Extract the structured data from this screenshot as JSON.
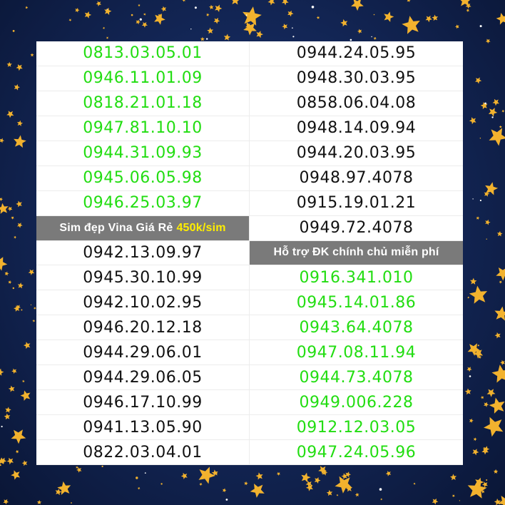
{
  "colors": {
    "green_number": "#22dd11",
    "black_number": "#111111",
    "banner_bg": "#7a7a7a",
    "banner_text": "#ffffff",
    "price_text": "#ffee00",
    "background": "#14285a",
    "star": "#f2b22e"
  },
  "left_column": [
    {
      "text": "0813.03.05.01",
      "color": "green"
    },
    {
      "text": "0946.11.01.09",
      "color": "green"
    },
    {
      "text": "0818.21.01.18",
      "color": "green"
    },
    {
      "text": "0947.81.10.10",
      "color": "green"
    },
    {
      "text": "0944.31.09.93",
      "color": "green"
    },
    {
      "text": "0945.06.05.98",
      "color": "green"
    },
    {
      "text": "0946.25.03.97",
      "color": "green"
    },
    {
      "text": "Sim đẹp Vina Giá Rẻ",
      "color": "banner",
      "price": "450k/sim"
    },
    {
      "text": "0942.13.09.97",
      "color": "black"
    },
    {
      "text": "0945.30.10.99",
      "color": "black"
    },
    {
      "text": "0942.10.02.95",
      "color": "black"
    },
    {
      "text": "0946.20.12.18",
      "color": "black"
    },
    {
      "text": "0944.29.06.01",
      "color": "black"
    },
    {
      "text": "0944.29.06.05",
      "color": "black"
    },
    {
      "text": "0946.17.10.99",
      "color": "black"
    },
    {
      "text": "0941.13.05.90",
      "color": "black"
    },
    {
      "text": "0822.03.04.01",
      "color": "black"
    }
  ],
  "right_column": [
    {
      "text": "0944.24.05.95",
      "color": "black"
    },
    {
      "text": "0948.30.03.95",
      "color": "black"
    },
    {
      "text": "0858.06.04.08",
      "color": "black"
    },
    {
      "text": "0948.14.09.94",
      "color": "black"
    },
    {
      "text": "0944.20.03.95",
      "color": "black"
    },
    {
      "text": "0948.97.4078",
      "color": "black"
    },
    {
      "text": "0915.19.01.21",
      "color": "black"
    },
    {
      "text": "0949.72.4078",
      "color": "black"
    },
    {
      "text": "Hỗ trợ ĐK chính chủ miễn phí",
      "color": "banner"
    },
    {
      "text": "0916.341.010",
      "color": "green"
    },
    {
      "text": "0945.14.01.86",
      "color": "green"
    },
    {
      "text": "0943.64.4078",
      "color": "green"
    },
    {
      "text": "0947.08.11.94",
      "color": "green"
    },
    {
      "text": "0944.73.4078",
      "color": "green"
    },
    {
      "text": "0949.006.228",
      "color": "green"
    },
    {
      "text": "0912.12.03.05",
      "color": "green"
    },
    {
      "text": "0947.24.05.96",
      "color": "green"
    }
  ]
}
